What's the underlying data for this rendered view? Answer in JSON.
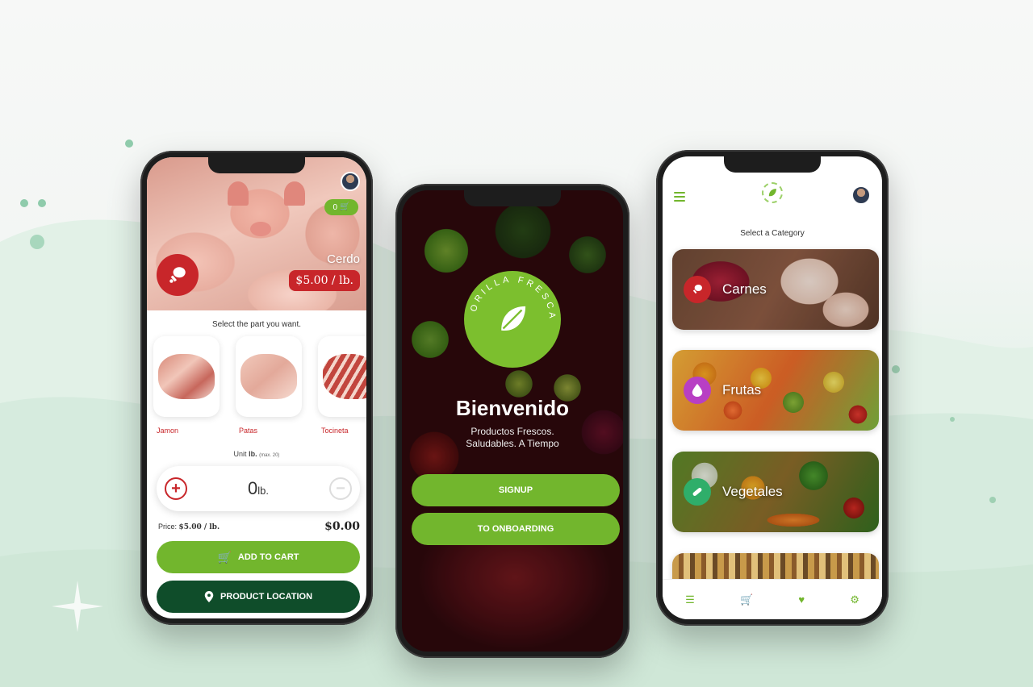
{
  "product_screen": {
    "title": "Cerdo",
    "price": "$5.00 / lb.",
    "cart_badge": "0",
    "select_prompt": "Select the part you want.",
    "parts": [
      {
        "label": "Jamon"
      },
      {
        "label": "Patas"
      },
      {
        "label": "Tocineta"
      }
    ],
    "unit_label": "Unit",
    "unit_value": "lb.",
    "unit_note": "(max. 20)",
    "quantity": "0",
    "quantity_unit": "lb.",
    "price_label": "Price:",
    "price_value": "$5.00 / lb.",
    "total": "$0.00",
    "add_to_cart": "ADD TO CART",
    "product_location": "PRODUCT LOCATION"
  },
  "welcome_screen": {
    "brand": "ORILLA FRESCA",
    "title": "Bienvenido",
    "tagline_line1": "Productos Frescos.",
    "tagline_line2": "Saludables. A Tiempo",
    "signup": "SIGNUP",
    "onboarding": "TO ONBOARDING"
  },
  "category_screen": {
    "prompt": "Select a Category",
    "categories": [
      {
        "name": "Carnes",
        "color": "#c8262a",
        "icon": "drumstick-icon"
      },
      {
        "name": "Frutas",
        "color": "#b83fc4",
        "icon": "drop-icon"
      },
      {
        "name": "Vegetales",
        "color": "#2fae6a",
        "icon": "pickle-icon"
      }
    ]
  },
  "colors": {
    "brand_green": "#72b62d",
    "dark_green": "#0f4d2a",
    "accent_red": "#c8262a"
  }
}
